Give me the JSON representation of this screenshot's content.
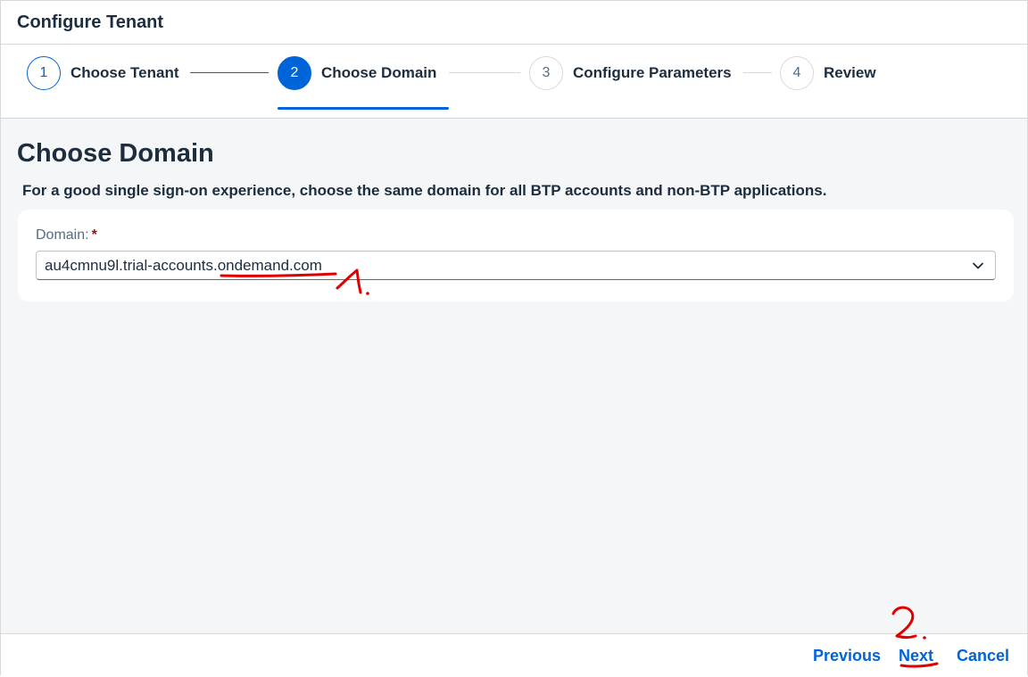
{
  "dialog": {
    "title": "Configure Tenant"
  },
  "wizard": {
    "steps": [
      {
        "number": "1",
        "label": "Choose Tenant",
        "state": "done"
      },
      {
        "number": "2",
        "label": "Choose Domain",
        "state": "active"
      },
      {
        "number": "3",
        "label": "Configure Parameters",
        "state": "todo"
      },
      {
        "number": "4",
        "label": "Review",
        "state": "todo"
      }
    ]
  },
  "main": {
    "title": "Choose Domain",
    "subtitle": "For a good single sign-on experience, choose the same domain for all BTP accounts and non-BTP applications.",
    "domain_field": {
      "label": "Domain:",
      "required_mark": "*",
      "value": "au4cmnu9l.trial-accounts.ondemand.com"
    }
  },
  "footer": {
    "previous_label": "Previous",
    "next_label": "Next",
    "cancel_label": "Cancel"
  },
  "annotations": {
    "marker_1": "1.",
    "marker_2": "2."
  },
  "colors": {
    "accent": "#0064d9",
    "text": "#1d2d3e",
    "background": "#f5f6f7",
    "required": "#aa0808",
    "annotation": "#e00000"
  },
  "icons": {
    "dropdown": "chevron-down-icon"
  }
}
